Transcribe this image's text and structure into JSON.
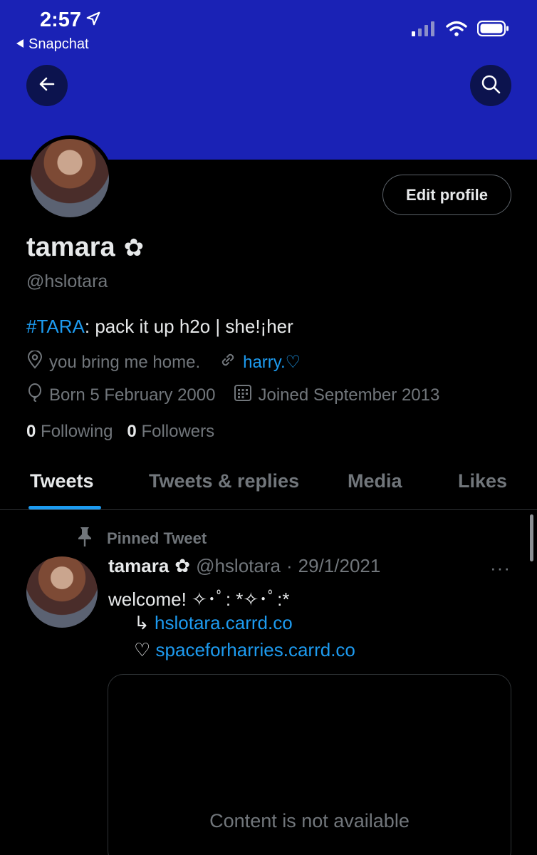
{
  "status_bar": {
    "time": "2:57",
    "back_app": "Snapchat"
  },
  "profile": {
    "edit_label": "Edit profile",
    "name": "tamara",
    "name_symbol": "✿",
    "handle": "@hslotara",
    "bio_tag": "#TARA",
    "bio_text": ": pack it up h2o | she!¡her",
    "location": "you bring me home.",
    "website": "harry.♡",
    "birthday": "Born 5 February 2000",
    "joined": "Joined September 2013",
    "following_count": "0",
    "following_label": "Following",
    "followers_count": "0",
    "followers_label": "Followers"
  },
  "tabs": [
    {
      "label": "Tweets"
    },
    {
      "label": "Tweets & replies"
    },
    {
      "label": "Media"
    },
    {
      "label": "Likes"
    }
  ],
  "pinned_tweet": {
    "pinned_label": "Pinned Tweet",
    "name": "tamara",
    "name_symbol": "✿",
    "handle": "@hslotara",
    "separator": "·",
    "date": "29/1/2021",
    "more": "···",
    "line1": "welcome! ✧･ﾟ: *✧･ﾟ:*",
    "line2_prefix": "↳",
    "line2_link": "hslotara.carrd.co",
    "line3_prefix": "♡",
    "line3_link": "spaceforharries.carrd.co",
    "card_text": "Content is not available"
  },
  "colors": {
    "banner": "#1a22b5",
    "accent": "#1d9bf0",
    "muted": "#71767b",
    "text": "#e7e9ea"
  }
}
